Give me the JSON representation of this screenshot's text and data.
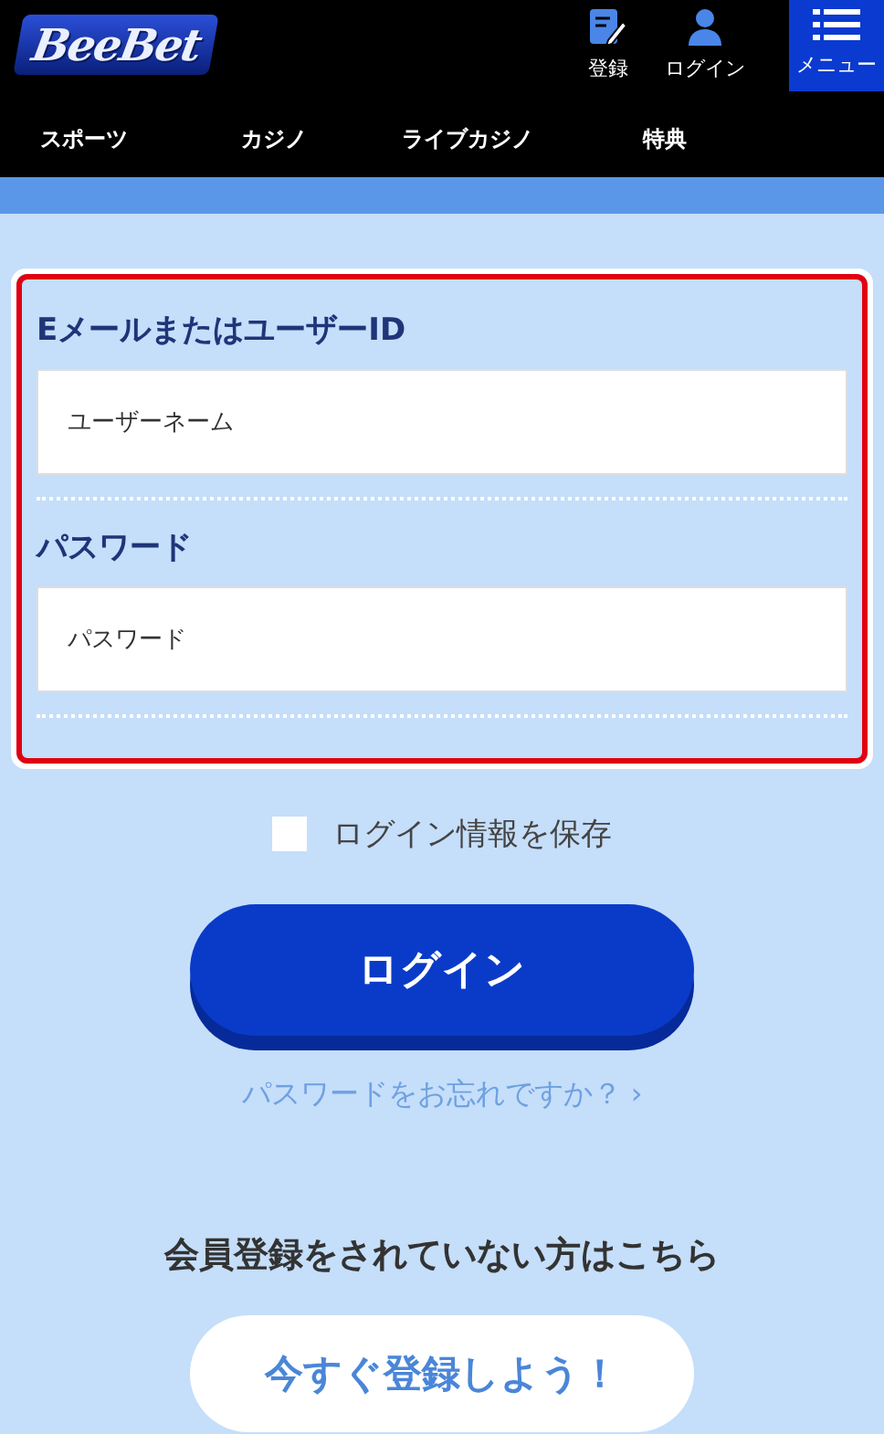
{
  "header": {
    "logo": "BeeBet",
    "actions": [
      {
        "kind": "register",
        "label": "登録"
      },
      {
        "kind": "login",
        "label": "ログイン"
      },
      {
        "kind": "menu",
        "label": "メニュー"
      }
    ]
  },
  "nav": [
    {
      "label": "スポーツ"
    },
    {
      "label": "カジノ"
    },
    {
      "label": "ライブカジノ"
    },
    {
      "label": "特典"
    }
  ],
  "form": {
    "fields": [
      {
        "label": "EメールまたはユーザーID",
        "placeholder": "ユーザーネーム"
      },
      {
        "label": "パスワード",
        "placeholder": "パスワード"
      }
    ],
    "remember": {
      "label": "ログイン情報を保存",
      "checked": false
    },
    "submit": "ログイン",
    "forgot": "パスワードをお忘れですか？ ›"
  },
  "signup": {
    "heading": "会員登録をされていない方はこちら",
    "button": "今すぐ登録しよう！"
  }
}
